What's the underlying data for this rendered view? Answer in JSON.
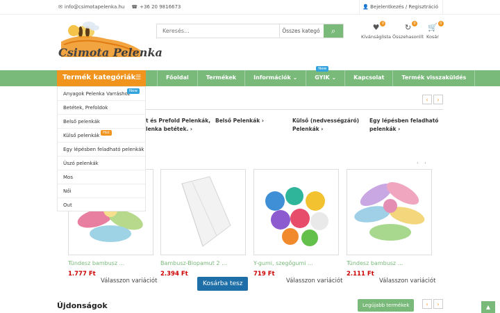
{
  "topbar": {
    "email": "info@csimotapelenka.hu",
    "phone": "+36 20 9816673",
    "login": "Bejelentkezés / Regisztráció"
  },
  "logo": {
    "part1": "Csimota",
    "part2": "Pelenka"
  },
  "search": {
    "placeholder": "Keresés...",
    "category": "Összes kategó"
  },
  "header_icons": {
    "wishlist": {
      "label": "Kívánságlista",
      "count": "0"
    },
    "compare": {
      "label": "Összehasonlít",
      "count": "0"
    },
    "cart": {
      "label": "Kosár",
      "count": "0"
    }
  },
  "nav": {
    "category_button": "Termék kategóriák",
    "items": [
      "Főoldal",
      "Termékek",
      "Információk",
      "GYIK",
      "Kapcsolat",
      "Termék visszaküldés"
    ],
    "gyik_badge": "New"
  },
  "dropdown": {
    "items": [
      "Anyagok Pelenka Varráshoz",
      "Betétek, Prefoldok",
      "Belső pelenkák",
      "Külső pelenkák",
      "Egy lépésben feladható pelenkák",
      "Úszó pelenkák",
      "Mos",
      "Női",
      "Out"
    ],
    "new_badge": "New",
    "hot_badge": "Hot"
  },
  "subcategories": [
    {
      "line1": "t és Prefold Pelenkák,",
      "line2": "lenka betétek."
    },
    {
      "line1": "Belső Pelenkák",
      "line2": ""
    },
    {
      "line1": "Külső (nedvességzáró)",
      "line2": "Pelenkák"
    },
    {
      "line1": "Egy lépésben feladható",
      "line2": "pelenkák"
    }
  ],
  "products": [
    {
      "name": "Tündesz bambusz ...",
      "price": "1.777 Ft",
      "action": "Válasszon variációt"
    },
    {
      "name": "Bambusz-Biopamut 2 ...",
      "price": "2.394 Ft",
      "action": "Kosárba tesz"
    },
    {
      "name": "Y-gumi, szegőgumi ...",
      "price": "719 Ft",
      "action": "Válasszon variációt"
    },
    {
      "name": "Tündesz bambusz ...",
      "price": "2.111 Ft",
      "action": "Válasszon variációt"
    }
  ],
  "section_new": {
    "title": "Újdonságok",
    "button": "Legújabb termékek"
  },
  "colors": {
    "accent_green": "#79b97a",
    "accent_orange": "#f0941e",
    "price_red": "#cc0000",
    "button_blue": "#1e6fa8"
  }
}
